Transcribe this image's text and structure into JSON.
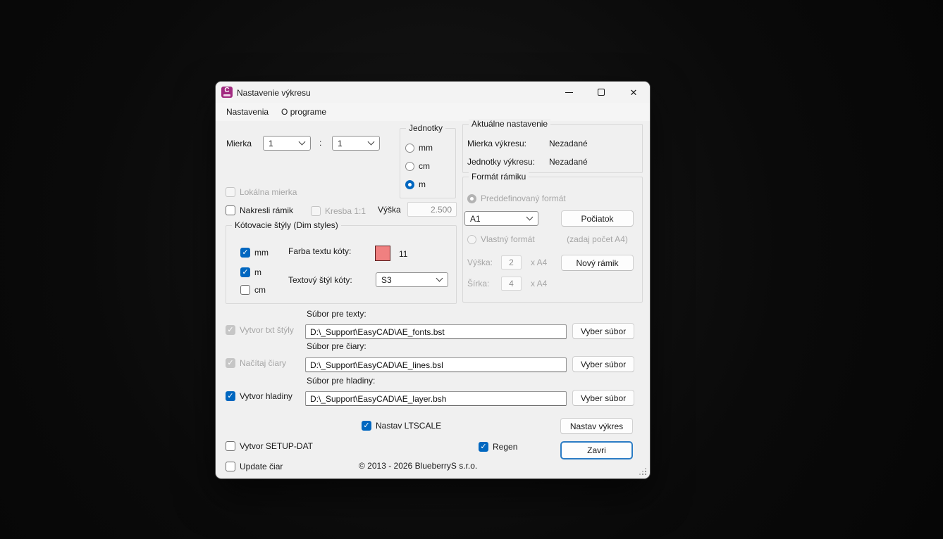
{
  "colors": {
    "accent": "#0067C0",
    "dim_color_swatch": "#F08080",
    "dialog_bg": "#F0F0F0",
    "app_icon_bg": "#A12A80"
  },
  "window": {
    "title": "Nastavenie výkresu",
    "icon_letter": "C"
  },
  "menu": {
    "items": [
      {
        "label": "Nastavenia"
      },
      {
        "label": "O programe"
      }
    ]
  },
  "scale_row": {
    "label": "Mierka",
    "numerator": "1",
    "colon": ":",
    "denominator": "1"
  },
  "units": {
    "title": "Jednotky",
    "options": [
      {
        "label": "mm",
        "selected": false
      },
      {
        "label": "cm",
        "selected": false
      },
      {
        "label": "m",
        "selected": true
      }
    ]
  },
  "current": {
    "title": "Aktuálne nastavenie",
    "rows": [
      {
        "label": "Mierka výkresu:",
        "value": "Nezadané"
      },
      {
        "label": "Jednotky výkresu:",
        "value": "Nezadané"
      }
    ]
  },
  "left_checks": {
    "lokalna": {
      "label": "Lokálna mierka",
      "checked": false,
      "disabled": true
    },
    "nakresli": {
      "label": "Nakresli rámik",
      "checked": false,
      "disabled": false
    },
    "kresba": {
      "label": "Kresba 1:1",
      "checked": false,
      "disabled": true
    }
  },
  "vyska": {
    "label": "Výška",
    "value": "2.500",
    "disabled": true
  },
  "dim_styles": {
    "title": "Kótovacie štýly (Dim styles)",
    "unit_checks": [
      {
        "label": "mm",
        "checked": true
      },
      {
        "label": "m",
        "checked": true
      },
      {
        "label": "cm",
        "checked": false
      }
    ],
    "color_label": "Farba textu kóty:",
    "color_number": "11",
    "color_hex": "#F08080",
    "style_label": "Textový štýl kóty:",
    "style_value": "S3"
  },
  "frame": {
    "title": "Formát rámiku",
    "predefined": {
      "label": "Preddefinovaný formát",
      "selected": true,
      "disabled": true
    },
    "format_value": "A1",
    "origin_button": "Počiatok",
    "custom": {
      "label": "Vlastný formát",
      "selected": false,
      "disabled": true
    },
    "hint": "(zadaj počet A4)",
    "height": {
      "label": "Výška:",
      "value": "2",
      "suffix": "x A4"
    },
    "width": {
      "label": "Šírka:",
      "value": "4",
      "suffix": "x A4"
    },
    "new_frame_button": "Nový rámik"
  },
  "files": {
    "rows": [
      {
        "section": "Súbor pre texty:",
        "check_label": "Vytvor txt štýly",
        "checked": true,
        "disabled": true,
        "path": "D:\\_Support\\EasyCAD\\AE_fonts.bst",
        "button": "Vyber súbor"
      },
      {
        "section": "Súbor pre čiary:",
        "check_label": "Načítaj čiary",
        "checked": true,
        "disabled": true,
        "path": "D:\\_Support\\EasyCAD\\AE_lines.bsl",
        "button": "Vyber súbor"
      },
      {
        "section": "Súbor pre hladiny:",
        "check_label": "Vytvor hladiny",
        "checked": true,
        "disabled": false,
        "path": "D:\\_Support\\EasyCAD\\AE_layer.bsh",
        "button": "Vyber súbor"
      }
    ]
  },
  "footer": {
    "ltscale": {
      "label": "Nastav LTSCALE",
      "checked": true
    },
    "setup_dat": {
      "label": "Vytvor SETUP-DAT",
      "checked": false
    },
    "update_ciar": {
      "label": "Update čiar",
      "checked": false
    },
    "regen": {
      "label": "Regen",
      "checked": true
    },
    "nastav_vykres_button": "Nastav výkres",
    "zavri_button": "Zavri",
    "copyright": "© 2013 - 2026 BlueberryS s.r.o."
  }
}
